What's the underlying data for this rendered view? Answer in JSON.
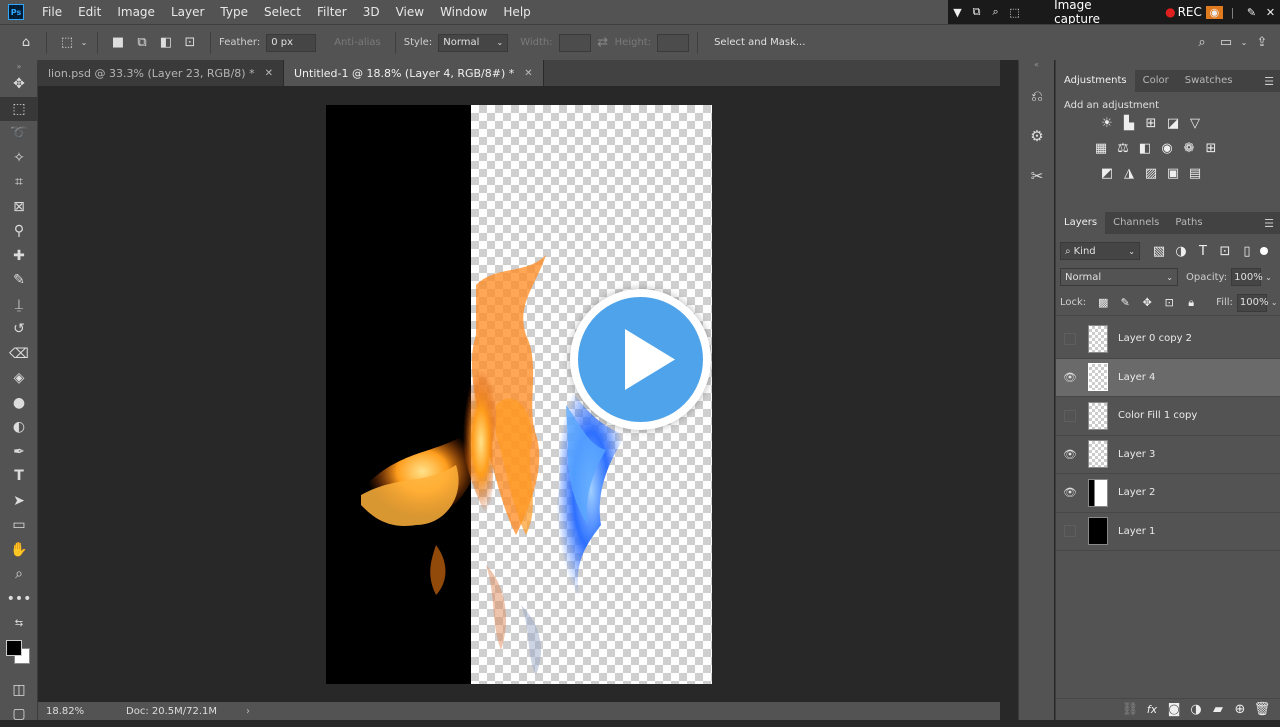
{
  "app": {
    "logo": "Ps",
    "menus": [
      "File",
      "Edit",
      "Image",
      "Layer",
      "Type",
      "Select",
      "Filter",
      "3D",
      "View",
      "Window",
      "Help"
    ]
  },
  "capture": {
    "label": "Image capture",
    "rec": "REC"
  },
  "options": {
    "feather_label": "Feather:",
    "feather_value": "0 px",
    "antialias_label": "Anti-alias",
    "style_label": "Style:",
    "style_value": "Normal",
    "width_label": "Width:",
    "height_label": "Height:",
    "select_mask": "Select and Mask..."
  },
  "tabs": [
    {
      "label": "lion.psd @ 33.3% (Layer 23, RGB/8) *"
    },
    {
      "label": "Untitled-1 @ 18.8% (Layer 4, RGB/8#) *"
    }
  ],
  "status": {
    "zoom": "18.82%",
    "doc": "Doc: 20.5M/72.1M"
  },
  "panels": {
    "adjustments_tabs": [
      "Adjustments",
      "Color",
      "Swatches"
    ],
    "adjustments_hint": "Add an adjustment",
    "layers_tabs": [
      "Layers",
      "Channels",
      "Paths"
    ],
    "filter_kind": "Kind",
    "blend_mode": "Normal",
    "opacity_label": "Opacity:",
    "opacity_value": "100%",
    "lock_label": "Lock:",
    "fill_label": "Fill:",
    "fill_value": "100%"
  },
  "layers": [
    {
      "name": "Layer 0 copy 2",
      "visible": false,
      "selected": false
    },
    {
      "name": "Layer 4",
      "visible": true,
      "selected": true
    },
    {
      "name": "Color Fill 1 copy",
      "visible": false,
      "selected": false
    },
    {
      "name": "Layer 3",
      "visible": true,
      "selected": false
    },
    {
      "name": "Layer 2",
      "visible": true,
      "selected": false
    },
    {
      "name": "Layer 1",
      "visible": false,
      "selected": false
    }
  ],
  "colors": {
    "accent": "#31a8ff",
    "play": "#4fa3ea",
    "rec": "#e0201e"
  }
}
